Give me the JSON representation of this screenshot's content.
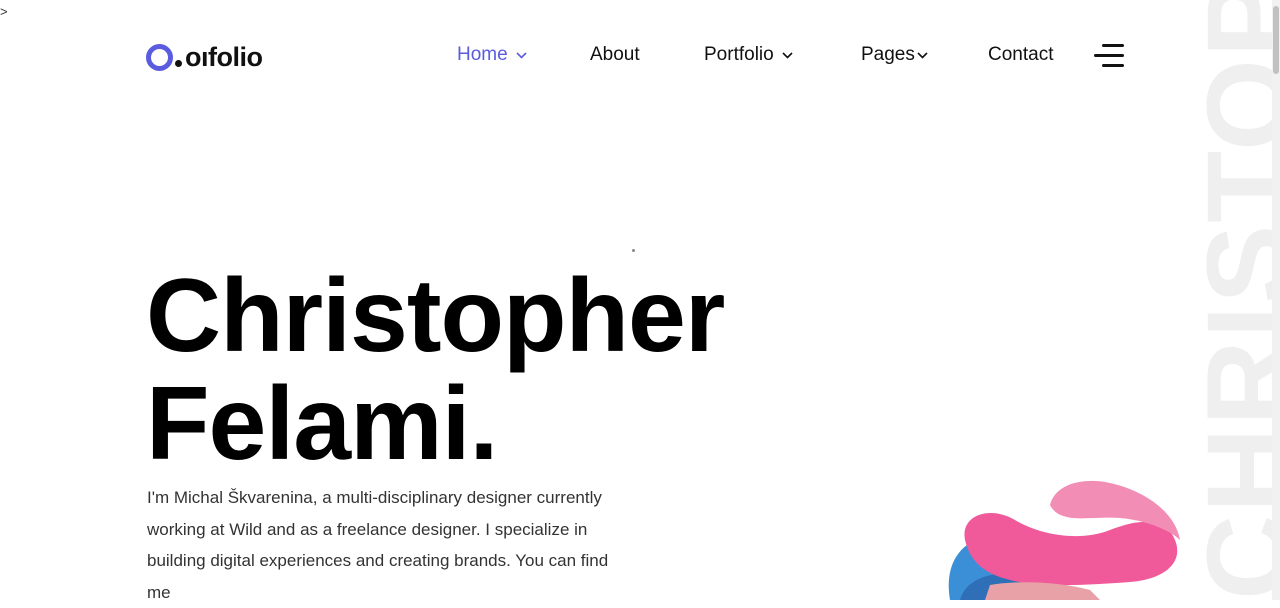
{
  "stray_char": ">",
  "logo": {
    "text": "oıfolio",
    "accent_color": "#5b5be0"
  },
  "nav": {
    "items": [
      {
        "label": "Home",
        "active": true,
        "dropdown": true
      },
      {
        "label": "About",
        "active": false,
        "dropdown": false
      },
      {
        "label": "Portfolio",
        "active": false,
        "dropdown": true
      },
      {
        "label": "Pages",
        "active": false,
        "dropdown": true
      },
      {
        "label": "Contact",
        "active": false,
        "dropdown": false
      }
    ],
    "menu_icon": "hamburger-menu-icon"
  },
  "hero": {
    "title": "Christopher\nFelami.",
    "description": "I'm Michal Škvarenina, a multi-disciplinary designer currently working at Wild and as a freelance designer. I specialize in building digital experiences and creating brands. You can find me",
    "vertical_text": "CHRISTOPHER"
  },
  "colors": {
    "accent": "#5b5be0",
    "text": "#111111",
    "muted_text": "#333333",
    "watermark": "#efefef"
  }
}
